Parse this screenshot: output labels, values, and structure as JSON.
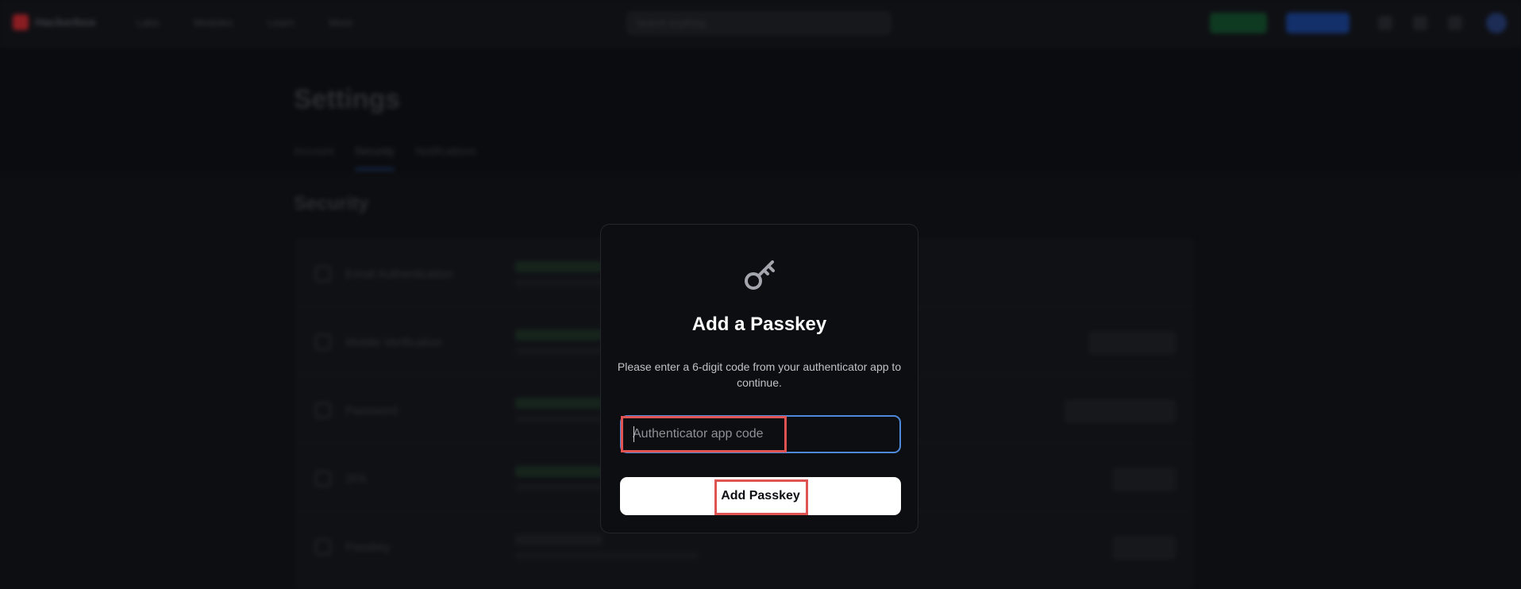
{
  "app": {
    "brand": "Hackerbox"
  },
  "nav": {
    "items": [
      "Labs",
      "Modules",
      "Learn",
      "More"
    ]
  },
  "search": {
    "placeholder": "Search anything..."
  },
  "page": {
    "title": "Settings",
    "tabs": [
      "Account",
      "Security",
      "Notifications"
    ],
    "active_tab": "Security",
    "section_title": "Security"
  },
  "security_rows": [
    {
      "label": "Email Authentication",
      "icon": "mail-icon"
    },
    {
      "label": "Mobile Verification",
      "icon": "phone-icon"
    },
    {
      "label": "Password",
      "icon": "lock-icon"
    },
    {
      "label": "2FA",
      "icon": "shield-icon"
    },
    {
      "label": "Passkey",
      "icon": "key-icon"
    }
  ],
  "modal": {
    "icon": "key-icon",
    "title": "Add a Passkey",
    "description": "Please enter a 6-digit code from your authenticator app to continue.",
    "input": {
      "placeholder": "Authenticator app code",
      "value": ""
    },
    "submit_label": "Add Passkey"
  },
  "colors": {
    "input_focus_border": "#4d88d9",
    "highlight": "#e05353",
    "modal_bg": "#0d0e12",
    "button_bg": "#ffffff"
  }
}
